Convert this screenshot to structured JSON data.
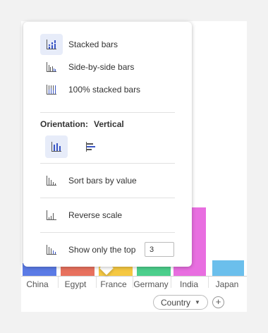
{
  "chart": {
    "categories": [
      "China",
      "Egypt",
      "France",
      "Germany",
      "India",
      "Japan"
    ],
    "bar_colors": [
      "#5b7be6",
      "#e8715e",
      "#f5c842",
      "#4ccf8c",
      "#e86ee0",
      "#6bbfec"
    ],
    "axis_selector": {
      "value": "Country"
    }
  },
  "menu": {
    "chart_types": [
      {
        "label": "Stacked bars",
        "icon": "stacked-bars-icon",
        "selected": true
      },
      {
        "label": "Side-by-side bars",
        "icon": "side-by-side-bars-icon",
        "selected": false
      },
      {
        "label": "100% stacked bars",
        "icon": "percent-stacked-bars-icon",
        "selected": false
      }
    ],
    "orientation": {
      "label": "Orientation:",
      "value": "Vertical",
      "options": [
        {
          "icon": "vertical-bars-icon",
          "selected": true
        },
        {
          "icon": "horizontal-bars-icon",
          "selected": false
        }
      ]
    },
    "sort_label": "Sort bars by value",
    "reverse_label": "Reverse scale",
    "top_n": {
      "label": "Show only the top",
      "value": "3"
    }
  },
  "accent_color": "#3a56c5"
}
